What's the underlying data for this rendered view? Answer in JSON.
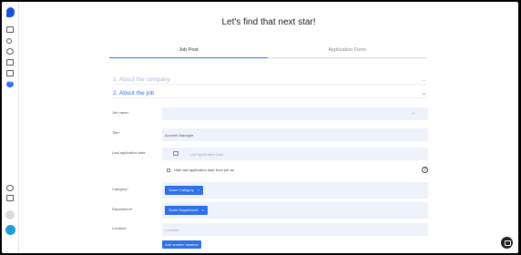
{
  "page": {
    "title": "Let's find that next star!"
  },
  "tabs": [
    "Job Post",
    "Application Form"
  ],
  "sections": [
    {
      "label": "1. About the company"
    },
    {
      "label": "2. About the job"
    }
  ],
  "fields": {
    "job_name": {
      "label": "Job name:",
      "value": ""
    },
    "title": {
      "label": "Title*",
      "value": "Account Manager"
    },
    "last_application_date": {
      "label": "Last application date",
      "placeholder": "Last Application Date"
    },
    "hide_checkbox": {
      "label": "Hide last application date from job ad"
    },
    "category": {
      "label": "Category*",
      "chip": "Some Category"
    },
    "department": {
      "label": "Department*",
      "chip": "Some Department"
    },
    "location": {
      "label": "Location:",
      "placeholder": "Location"
    }
  },
  "buttons": {
    "add_location": "Add another location"
  },
  "icons": {
    "close": "×",
    "chevron_down": "⌄",
    "help": "?"
  },
  "colors": {
    "accent": "#2f6fe8",
    "field_bg": "#eef2fb"
  }
}
